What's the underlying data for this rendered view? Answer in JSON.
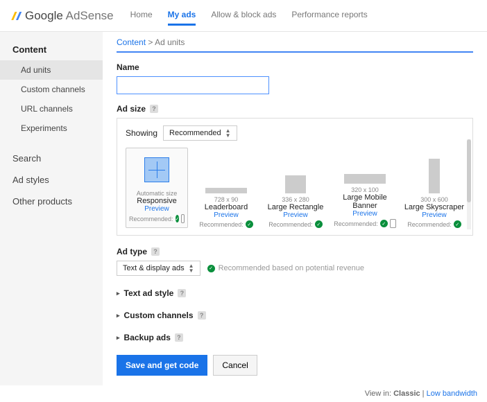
{
  "header": {
    "brand_google": "Google",
    "brand_product": "AdSense",
    "tabs": {
      "home": "Home",
      "myads": "My ads",
      "allow": "Allow & block ads",
      "perf": "Performance reports"
    }
  },
  "sidebar": {
    "content_label": "Content",
    "items": {
      "adunits": "Ad units",
      "custom": "Custom channels",
      "url": "URL channels",
      "experiments": "Experiments"
    },
    "search": "Search",
    "adstyles": "Ad styles",
    "other": "Other products"
  },
  "breadcrumb": {
    "content": "Content",
    "sep": ">",
    "current": "Ad units"
  },
  "form": {
    "name_label": "Name",
    "name_value": "",
    "adsize_label": "Ad size",
    "showing_label": "Showing",
    "showing_value": "Recommended",
    "adtype_label": "Ad type",
    "adtype_value": "Text & display ads",
    "adtype_hint": "Recommended based on potential revenue",
    "sections": {
      "textstyle": "Text ad style",
      "custom": "Custom channels",
      "backup": "Backup ads"
    },
    "save": "Save and get code",
    "cancel": "Cancel"
  },
  "sizes": {
    "responsive": {
      "dim": "Automatic size",
      "name": "Responsive",
      "preview": "Preview",
      "rec": "Recommended:"
    },
    "leader": {
      "dim": "728 x 90",
      "name": "Leaderboard",
      "preview": "Preview",
      "rec": "Recommended:"
    },
    "rect": {
      "dim": "336 x 280",
      "name": "Large Rectangle",
      "preview": "Preview",
      "rec": "Recommended:"
    },
    "mobile": {
      "dim": "320 x 100",
      "name": "Large Mobile Banner",
      "preview": "Preview",
      "rec": "Recommended:"
    },
    "sky": {
      "dim": "300 x 600",
      "name": "Large Skyscraper",
      "preview": "Preview",
      "rec": "Recommended:"
    }
  },
  "footer": {
    "viewin": "View in:",
    "classic": "Classic",
    "low": "Low bandwidth"
  }
}
